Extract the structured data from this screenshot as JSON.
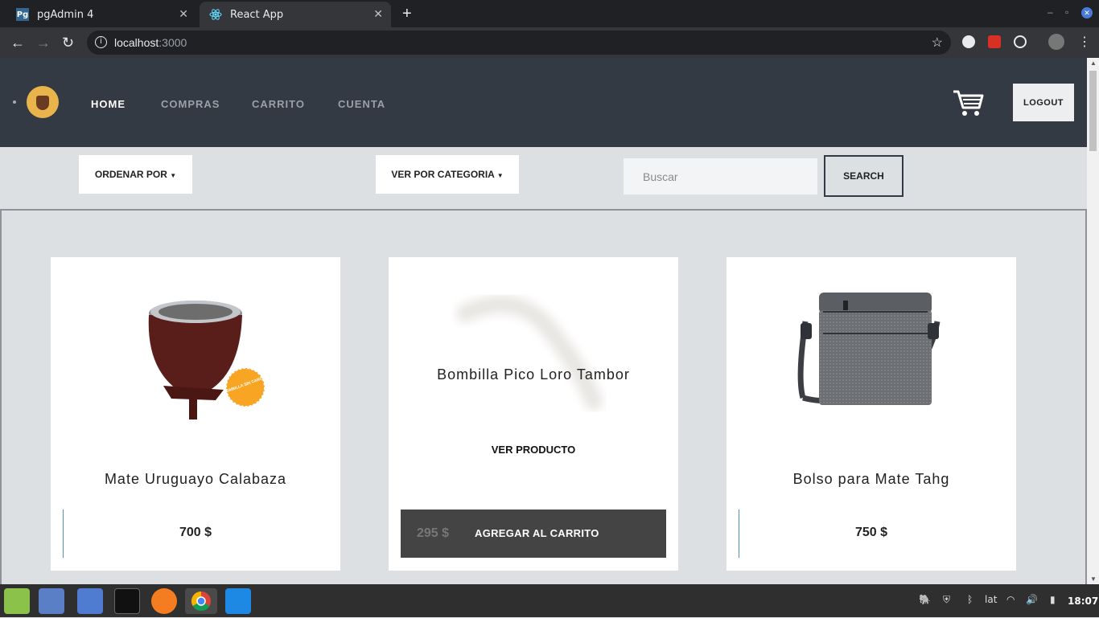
{
  "browser": {
    "tabs": [
      {
        "title": "pgAdmin 4",
        "favicon": "Pg"
      },
      {
        "title": "React App",
        "favicon": "react-icon"
      }
    ],
    "url_host": "localhost",
    "url_port": ":3000"
  },
  "header": {
    "nav": [
      "HOME",
      "COMPRAS",
      "CARRITO",
      "CUENTA"
    ],
    "logout_label": "LOGOUT"
  },
  "filters": {
    "order_label": "ORDENAR POR",
    "category_label": "VER POR CATEGORIA",
    "search_placeholder": "Buscar",
    "search_label": "SEARCH"
  },
  "products": [
    {
      "name": "Mate Uruguayo Calabaza",
      "price": "700 $",
      "badge_text": "BOMBILLA SIN CARGO"
    },
    {
      "name": "Bombilla Pico Loro Tambor",
      "price": "295 $",
      "view_label": "VER PRODUCTO",
      "add_label": "AGREGAR AL CARRITO"
    },
    {
      "name": "Bolso para Mate Tahg",
      "price": "750 $"
    }
  ],
  "taskbar": {
    "keyboard_layout": "lat",
    "time": "18:07"
  },
  "colors": {
    "header_bg": "#343a43",
    "page_bg": "#dde0e3",
    "accent_line": "#4a8fb5"
  }
}
